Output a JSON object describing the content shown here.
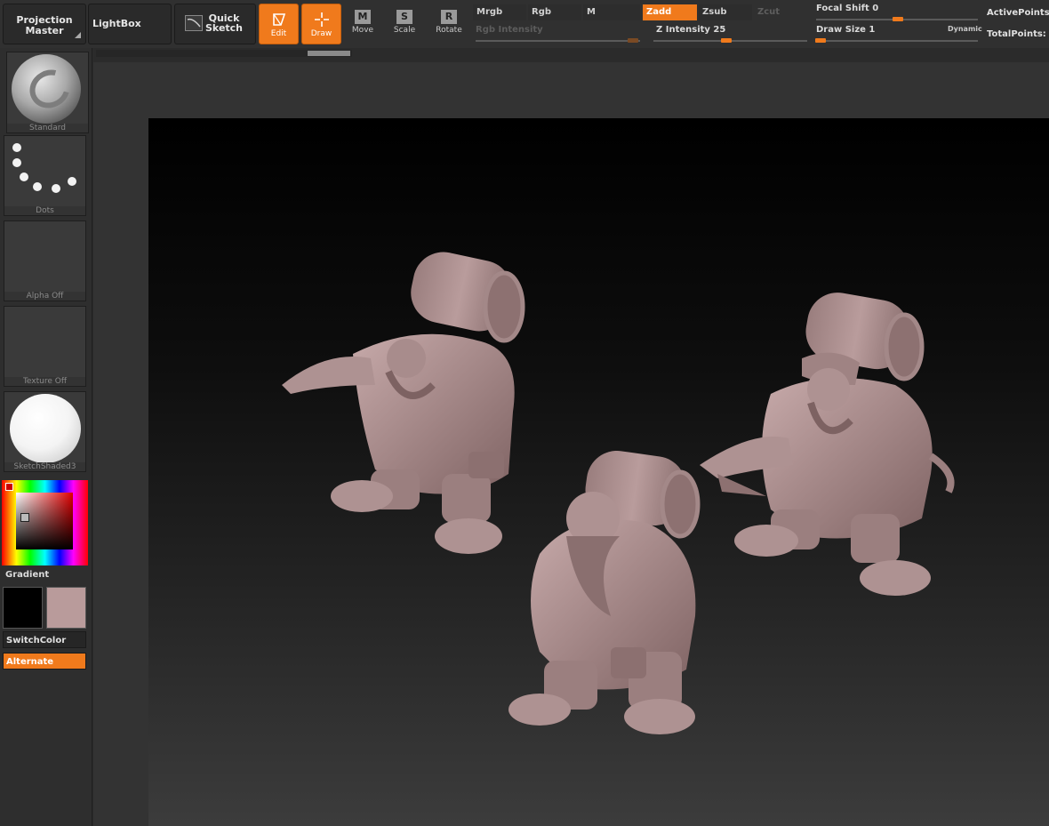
{
  "toolbar": {
    "projection_master": "Projection\nMaster",
    "lightbox": "LightBox",
    "quick_sketch": "Quick\nSketch",
    "edit": "Edit",
    "draw": "Draw",
    "move": "Move",
    "scale": "Scale",
    "rotate": "Rotate",
    "move_key": "M",
    "scale_key": "S",
    "rotate_key": "R"
  },
  "channels": {
    "mrgb": "Mrgb",
    "rgb": "Rgb",
    "m": "M",
    "zadd": "Zadd",
    "zsub": "Zsub",
    "zcut": "Zcut"
  },
  "sliders": {
    "rgb_intensity": "Rgb Intensity",
    "z_intensity": "Z Intensity 25",
    "focal_shift": "Focal Shift 0",
    "draw_size": "Draw Size 1",
    "dynamic": "Dynamic"
  },
  "stats": {
    "active_points": "ActivePoints:",
    "total_points": "TotalPoints:"
  },
  "palette": {
    "brush": "Standard",
    "stroke": "Dots",
    "alpha": "Alpha Off",
    "texture": "Texture Off",
    "material": "SketchShaded3",
    "gradient": "Gradient",
    "switch_color": "SwitchColor",
    "alternate": "Alternate"
  },
  "colors": {
    "accent": "#f07a1c",
    "main_color": "#b99b9b",
    "secondary_color": "#000000",
    "model_color": "#a98d8d"
  }
}
